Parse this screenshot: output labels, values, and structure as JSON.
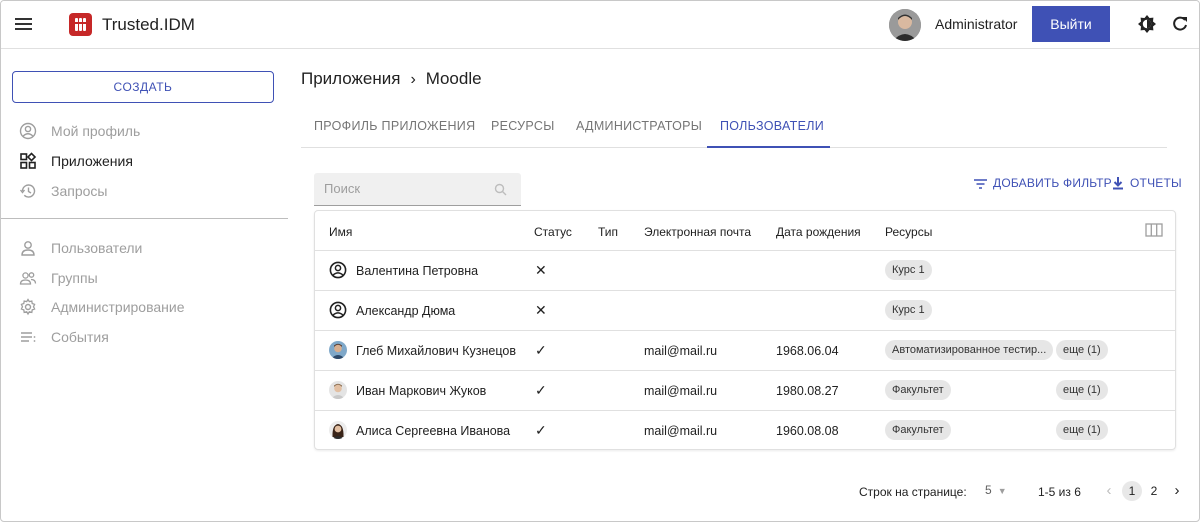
{
  "header": {
    "app_title": "Trusted.IDM",
    "user_name": "Administrator",
    "logout_label": "Выйти"
  },
  "sidebar": {
    "create_label": "СОЗДАТЬ",
    "items": [
      {
        "label": "Мой профиль",
        "icon": "account-circle-icon"
      },
      {
        "label": "Приложения",
        "icon": "apps-icon"
      },
      {
        "label": "Запросы",
        "icon": "history-icon"
      },
      {
        "label": "Пользователи",
        "icon": "person-icon"
      },
      {
        "label": "Группы",
        "icon": "group-icon"
      },
      {
        "label": "Администрирование",
        "icon": "gear-icon"
      },
      {
        "label": "События",
        "icon": "list-icon"
      }
    ]
  },
  "breadcrumb": {
    "parent": "Приложения",
    "current": "Moodle"
  },
  "tabs": [
    {
      "label": "ПРОФИЛЬ ПРИЛОЖЕНИЯ"
    },
    {
      "label": "РЕСУРСЫ"
    },
    {
      "label": "АДМИНИСТРАТОРЫ"
    },
    {
      "label": "ПОЛЬЗОВАТЕЛИ",
      "active": true
    }
  ],
  "search": {
    "placeholder": "Поиск"
  },
  "actions": {
    "filter_label": "ДОБАВИТЬ ФИЛЬТР",
    "reports_label": "ОТЧЕТЫ"
  },
  "table": {
    "columns": [
      "Имя",
      "Статус",
      "Тип",
      "Электронная почта",
      "Дата рождения",
      "Ресурсы"
    ],
    "rows": [
      {
        "name": "Валентина Петровна",
        "status": "✕",
        "type": "",
        "email": "",
        "birth": "",
        "resource": "Курс 1",
        "more": "",
        "avatar": "default"
      },
      {
        "name": "Александр Дюма",
        "status": "✕",
        "type": "",
        "email": "",
        "birth": "",
        "resource": "Курс 1",
        "more": "",
        "avatar": "default"
      },
      {
        "name": "Глеб Михайлович Кузнецов",
        "status": "✓",
        "type": "",
        "email": "mail@mail.ru",
        "birth": "1968.06.04",
        "resource": "Автоматизированное тестир...",
        "more": "еще (1)",
        "avatar": "photo"
      },
      {
        "name": "Иван Маркович Жуков",
        "status": "✓",
        "type": "",
        "email": "mail@mail.ru",
        "birth": "1980.08.27",
        "resource": "Факультет",
        "more": "еще (1)",
        "avatar": "photo"
      },
      {
        "name": "Алиса Сергеевна Иванова",
        "status": "✓",
        "type": "",
        "email": "mail@mail.ru",
        "birth": "1960.08.08",
        "resource": "Факультет",
        "more": "еще (1)",
        "avatar": "photo"
      }
    ]
  },
  "pagination": {
    "rows_label": "Строк на странице:",
    "rows_value": "5",
    "range": "1-5 из 6",
    "pages": [
      "1",
      "2"
    ],
    "current_page": "1"
  },
  "colors": {
    "accent": "#3f51b5",
    "logo": "#c62828"
  }
}
